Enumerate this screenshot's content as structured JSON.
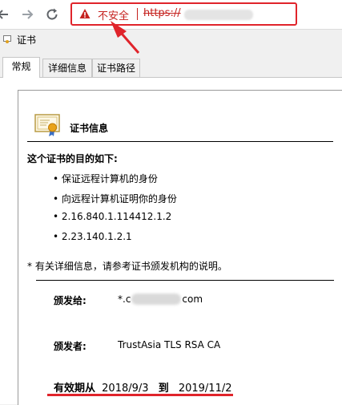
{
  "browser": {
    "back_icon": "back-arrow-icon",
    "forward_icon": "forward-arrow-icon",
    "reload_icon": "reload-icon",
    "security_label": "不安全",
    "url_scheme": "https://",
    "url_tail": "",
    "accent_color": "#e0242b"
  },
  "window": {
    "title": "证书"
  },
  "tabs": [
    {
      "label": "常规",
      "active": true
    },
    {
      "label": "详细信息",
      "active": false
    },
    {
      "label": "证书路径",
      "active": false
    }
  ],
  "cert": {
    "info_title": "证书信息",
    "purpose_heading": "这个证书的目的如下:",
    "purposes": [
      "• 保证远程计算机的身份",
      "• 向远程计算机证明你的身份",
      "• 2.16.840.1.114412.1.2",
      "• 2.23.140.1.2.1"
    ],
    "footnote": "* 有关详细信息，请参考证书颁发机构的说明。",
    "issued_to_label": "颁发给:",
    "issued_to_prefix": "*.c",
    "issued_to_suffix": "com",
    "issued_by_label": "颁发者:",
    "issued_by_value": "TrustAsia TLS RSA CA",
    "validity_from_label": "有效期从",
    "validity_from": "2018/9/3",
    "validity_to_label": "到",
    "validity_to": "2019/11/2"
  }
}
